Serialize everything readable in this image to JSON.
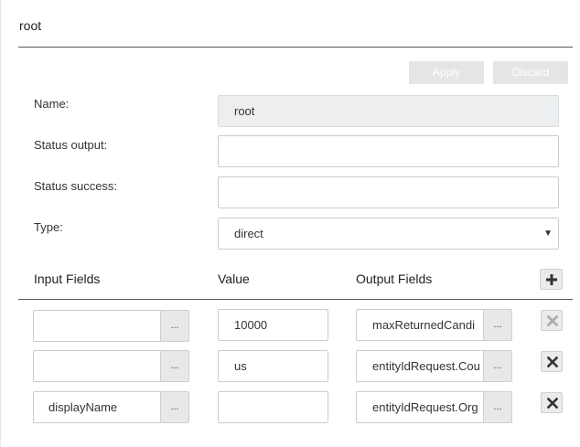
{
  "header": {
    "title": "root"
  },
  "actions": {
    "apply_label": "Apply",
    "discard_label": "Discard"
  },
  "form": {
    "name_label": "Name:",
    "name_value": "root",
    "status_output_label": "Status output:",
    "status_output_value": "",
    "status_success_label": "Status success:",
    "status_success_value": "",
    "type_label": "Type:",
    "type_value": "direct"
  },
  "table": {
    "headers": {
      "input_fields": "Input Fields",
      "value": "Value",
      "output_fields": "Output Fields"
    },
    "dots_label": "...",
    "rows": [
      {
        "input": "",
        "value": "10000",
        "output": "maxReturnedCandi",
        "delete_enabled": false
      },
      {
        "input": "",
        "value": "us",
        "output": "entityIdRequest.Cou",
        "delete_enabled": true
      },
      {
        "input": "displayName",
        "value": "",
        "output": "entityIdRequest.Org",
        "delete_enabled": true
      }
    ]
  },
  "icons": {
    "add": "plus-icon",
    "delete": "close-icon",
    "dropdown": "caret-down-icon"
  },
  "colors": {
    "icon_enabled": "#333333",
    "icon_disabled": "#aaaaaa",
    "disabled_button_bg": "#e5e5e5"
  }
}
